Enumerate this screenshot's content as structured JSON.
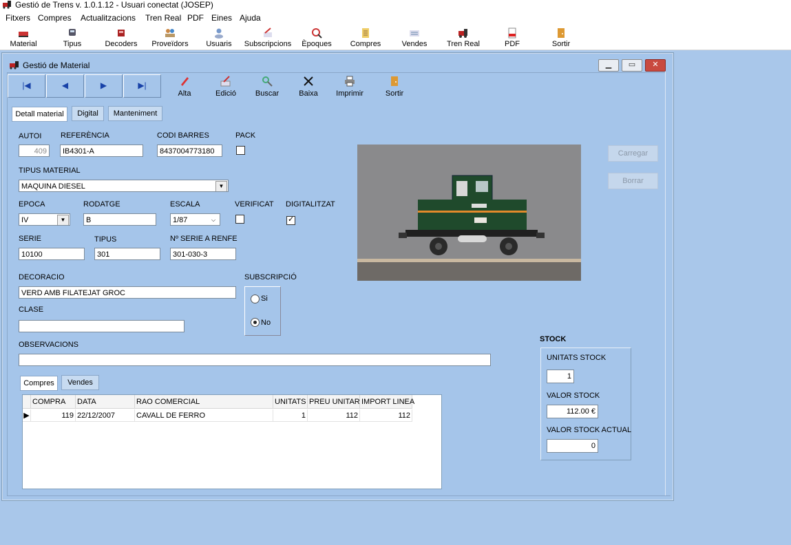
{
  "app": {
    "title": "Gestió de Trens v. 1.0.1.12 - Usuari conectat (JOSEP)",
    "menu": [
      "Fitxers",
      "Compres",
      "Actualitzacions",
      "Tren Real",
      "PDF",
      "Eines",
      "Ajuda"
    ],
    "toolbar": [
      "Material",
      "Tipus",
      "Decoders",
      "Proveïdors",
      "Usuaris",
      "Subscripcions",
      "Èpoques",
      "Compres",
      "Vendes",
      "Tren Real",
      "PDF",
      "Sortir"
    ]
  },
  "window": {
    "title": "Gestió de Material",
    "actions": {
      "alta": "Alta",
      "edicio": "Edició",
      "buscar": "Buscar",
      "baixa": "Baixa",
      "imprimir": "Imprimir",
      "sortir": "Sortir"
    },
    "tabs": [
      "Detall material",
      "Digital",
      "Manteniment"
    ]
  },
  "form": {
    "autoi_label": "AUTOI",
    "autoi": "409",
    "referencia_label": "REFERÈNCIA",
    "referencia": "IB4301-A",
    "codi_barres_label": "CODI BARRES",
    "codi_barres": "8437004773180",
    "pack_label": "PACK",
    "tipus_material_label": "TIPUS MATERIAL",
    "tipus_material": "MAQUINA DIESEL",
    "epoca_label": "EPOCA",
    "epoca": "IV",
    "rodatge_label": "RODATGE",
    "rodatge": "B",
    "escala_label": "ESCALA",
    "escala": "1/87",
    "verificat_label": "VERIFICAT",
    "digitalitzat_label": "DIGITALITZAT",
    "serie_label": "SERIE",
    "serie": "10100",
    "tipus_label": "TIPUS",
    "tipus": "301",
    "serie_renfe_label": "Nº SERIE A RENFE",
    "serie_renfe": "301-030-3",
    "decoracio_label": "DECORACIO",
    "decoracio": "VERD AMB FILATEJAT GROC",
    "subscripcio_label": "SUBSCRIPCIÓ",
    "subscripcio_si": "Si",
    "subscripcio_no": "No",
    "clase_label": "CLASE",
    "clase": "",
    "observacions_label": "OBSERVACIONS",
    "observacions": "",
    "carregar": "Carregar",
    "borrar": "Borrar"
  },
  "stock": {
    "title": "STOCK",
    "unitats_label": "UNITATS STOCK",
    "unitats": "1",
    "valor_label": "VALOR STOCK",
    "valor": "112.00 €",
    "actual_label": "VALOR STOCK ACTUAL",
    "actual": "0"
  },
  "grid": {
    "tabs": [
      "Compres",
      "Vendes"
    ],
    "headers": [
      "COMPRA",
      "DATA",
      "RAO COMERCIAL",
      "UNITATS",
      "PREU UNITARI",
      "IMPORT LINEA"
    ],
    "rows": [
      {
        "compra": "119",
        "data": "22/12/2007",
        "rao": "CAVALL DE FERRO",
        "unitats": "1",
        "preu": "112",
        "import": "112"
      }
    ]
  }
}
